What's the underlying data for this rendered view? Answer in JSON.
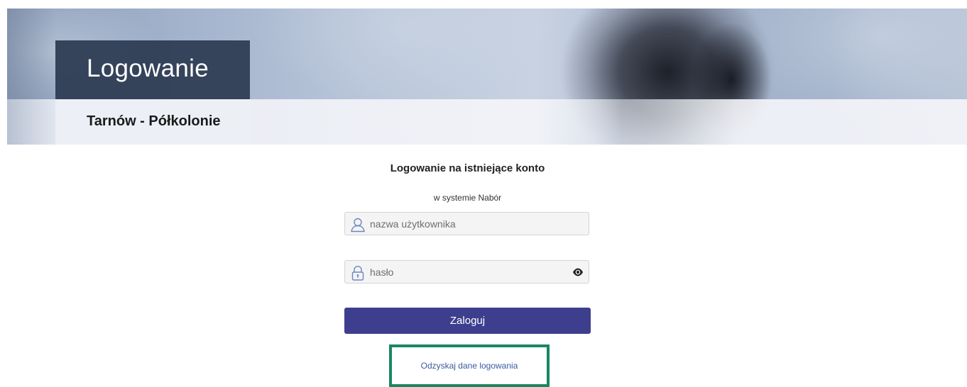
{
  "banner": {
    "title": "Logowanie",
    "subtitle": "Tarnów - Półkolonie"
  },
  "login": {
    "heading": "Logowanie na istniejące konto",
    "subheading": "w systemie Nabór",
    "username": {
      "placeholder": "nazwa użytkownika",
      "value": "",
      "icon": "user-icon"
    },
    "password": {
      "placeholder": "hasło",
      "value": "",
      "icon": "lock-icon",
      "toggle_icon": "eye-icon"
    },
    "submit_label": "Zaloguj",
    "recover_label": "Odzyskaj dane logowania"
  },
  "colors": {
    "button": "#3d3f8e",
    "highlight": "#1a8760",
    "title_box": "#2c3a52",
    "link": "#3a5a9e",
    "icon": "#6b86c4"
  }
}
